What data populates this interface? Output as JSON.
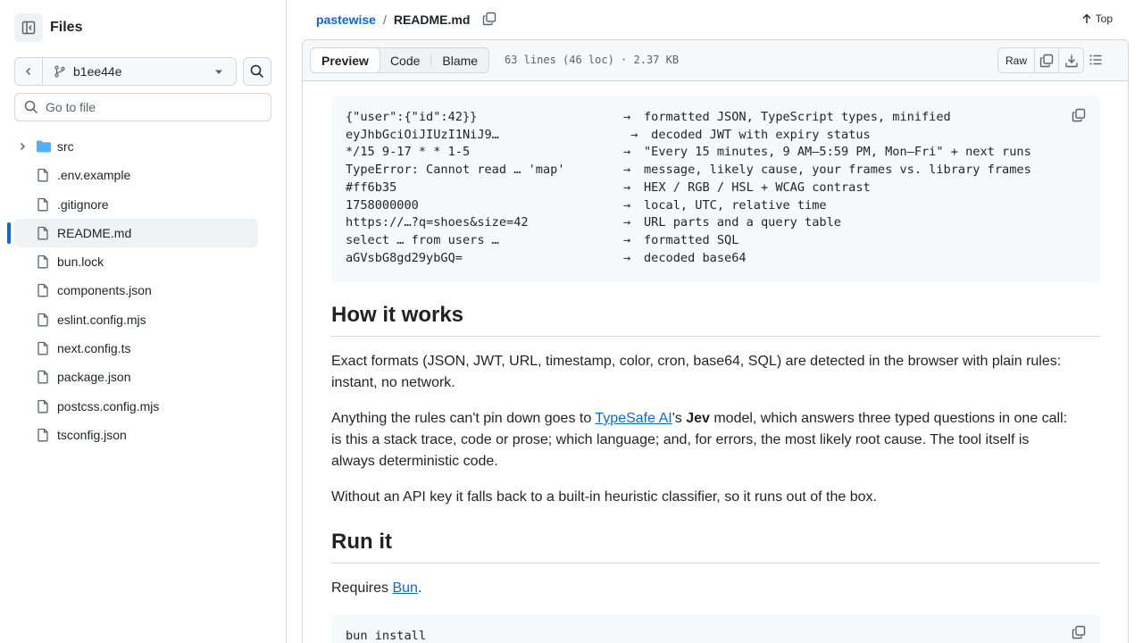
{
  "sidebar": {
    "title": "Files",
    "branch": "b1ee44e",
    "goto_placeholder": "Go to file",
    "items": [
      {
        "label": "src",
        "type": "folder"
      },
      {
        "label": ".env.example",
        "type": "file"
      },
      {
        "label": ".gitignore",
        "type": "file"
      },
      {
        "label": "README.md",
        "type": "file",
        "active": true
      },
      {
        "label": "bun.lock",
        "type": "file"
      },
      {
        "label": "components.json",
        "type": "file"
      },
      {
        "label": "eslint.config.mjs",
        "type": "file"
      },
      {
        "label": "next.config.ts",
        "type": "file"
      },
      {
        "label": "package.json",
        "type": "file"
      },
      {
        "label": "postcss.config.mjs",
        "type": "file"
      },
      {
        "label": "tsconfig.json",
        "type": "file"
      }
    ]
  },
  "breadcrumb": {
    "repo": "pastewise",
    "separator": "/",
    "file": "README.md"
  },
  "top_link": "Top",
  "filebar": {
    "tabs": [
      "Preview",
      "Code",
      "Blame"
    ],
    "active_tab": "Preview",
    "info": "63 lines (46 loc) · 2.37 KB",
    "raw": "Raw"
  },
  "readme": {
    "examples": [
      {
        "input": "{\"user\":{\"id\":42}}",
        "arrow": "→",
        "output": "formatted JSON, TypeScript types, minified"
      },
      {
        "input": "eyJhbGciOiJIUzI1NiJ9…",
        "arrow": " →",
        "output": " decoded JWT with expiry status"
      },
      {
        "input": "*/15 9-17 * * 1-5",
        "arrow": "→",
        "output": "\"Every 15 minutes, 9 AM–5:59 PM, Mon–Fri\" + next runs"
      },
      {
        "input": "TypeError: Cannot read … 'map'",
        "arrow": "→",
        "output": "message, likely cause, your frames vs. library frames"
      },
      {
        "input": "#ff6b35",
        "arrow": "→",
        "output": "HEX / RGB / HSL + WCAG contrast"
      },
      {
        "input": "1758000000",
        "arrow": "→",
        "output": "local, UTC, relative time"
      },
      {
        "input": "https://…?q=shoes&size=42",
        "arrow": "→",
        "output": "URL parts and a query table"
      },
      {
        "input": "select … from users …",
        "arrow": "→",
        "output": "formatted SQL"
      },
      {
        "input": "aGVsbG8gd29ybGQ=",
        "arrow": "→",
        "output": "decoded base64"
      }
    ],
    "h_how": "How it works",
    "p1": "Exact formats (JSON, JWT, URL, timestamp, color, cron, base64, SQL) are detected in the browser with plain rules: instant, no network.",
    "p2_a": "Anything the rules can't pin down goes to ",
    "p2_link": "TypeSafe AI",
    "p2_b": "'s ",
    "p2_bold": "Jev",
    "p2_c": " model, which answers three typed questions in one call: is this a stack trace, code or prose; which language; and, for errors, the most likely root cause. The tool itself is always deterministic code.",
    "p3": "Without an API key it falls back to a built-in heuristic classifier, so it runs out of the box.",
    "h_run": "Run it",
    "p4_a": "Requires ",
    "p4_link": "Bun",
    "p4_b": ".",
    "run_cmd": "bun install"
  },
  "colors": {
    "accent": "#0969da",
    "border": "#d1d9e0",
    "folder": "#54aeff"
  }
}
